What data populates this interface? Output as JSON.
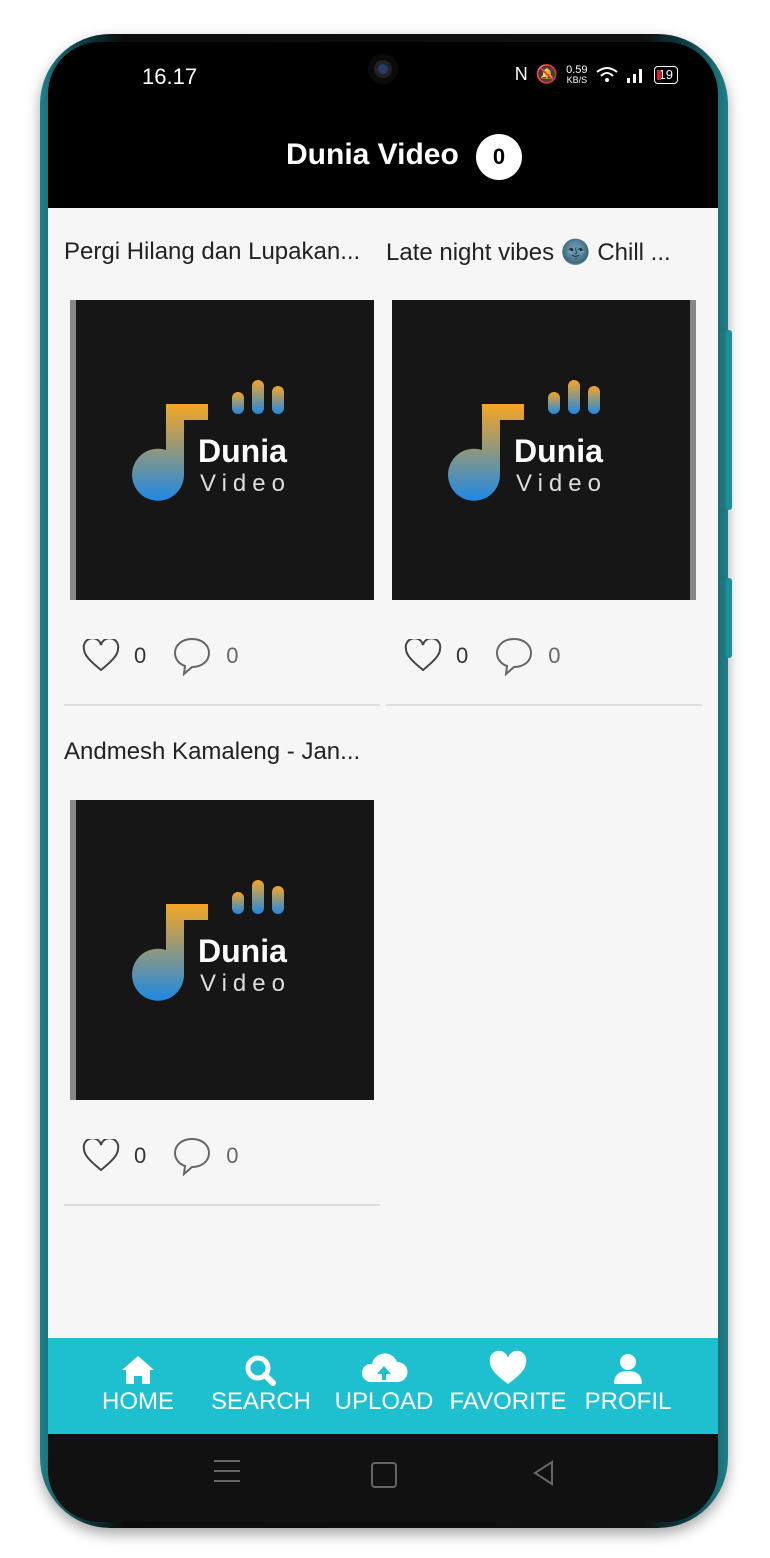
{
  "status_bar": {
    "time": "16.17",
    "net_speed_value": "0.59",
    "net_speed_unit": "KB/S",
    "battery": "19"
  },
  "header": {
    "title": "Dunia Video",
    "badge_count": "0"
  },
  "logo": {
    "word1": "Dunia",
    "word2": "Video"
  },
  "videos": [
    {
      "title": "Pergi Hilang dan Lupakan...",
      "likes": "0",
      "comments": "0"
    },
    {
      "title": "Late night vibes 🌚 Chill ...",
      "likes": "0",
      "comments": "0"
    },
    {
      "title": "Andmesh Kamaleng - Jan...",
      "likes": "0",
      "comments": "0"
    }
  ],
  "bottom_nav": [
    {
      "label": "HOME",
      "icon": "home-icon"
    },
    {
      "label": "SEARCH",
      "icon": "search-icon"
    },
    {
      "label": "UPLOAD",
      "icon": "cloud-upload-icon"
    },
    {
      "label": "FAVORITE",
      "icon": "heart-icon"
    },
    {
      "label": "PROFIL",
      "icon": "user-icon"
    }
  ],
  "colors": {
    "accent": "#1ec0d0",
    "header_bg": "#000000",
    "logo_orange": "#f5a623",
    "logo_blue": "#1e88e5"
  }
}
